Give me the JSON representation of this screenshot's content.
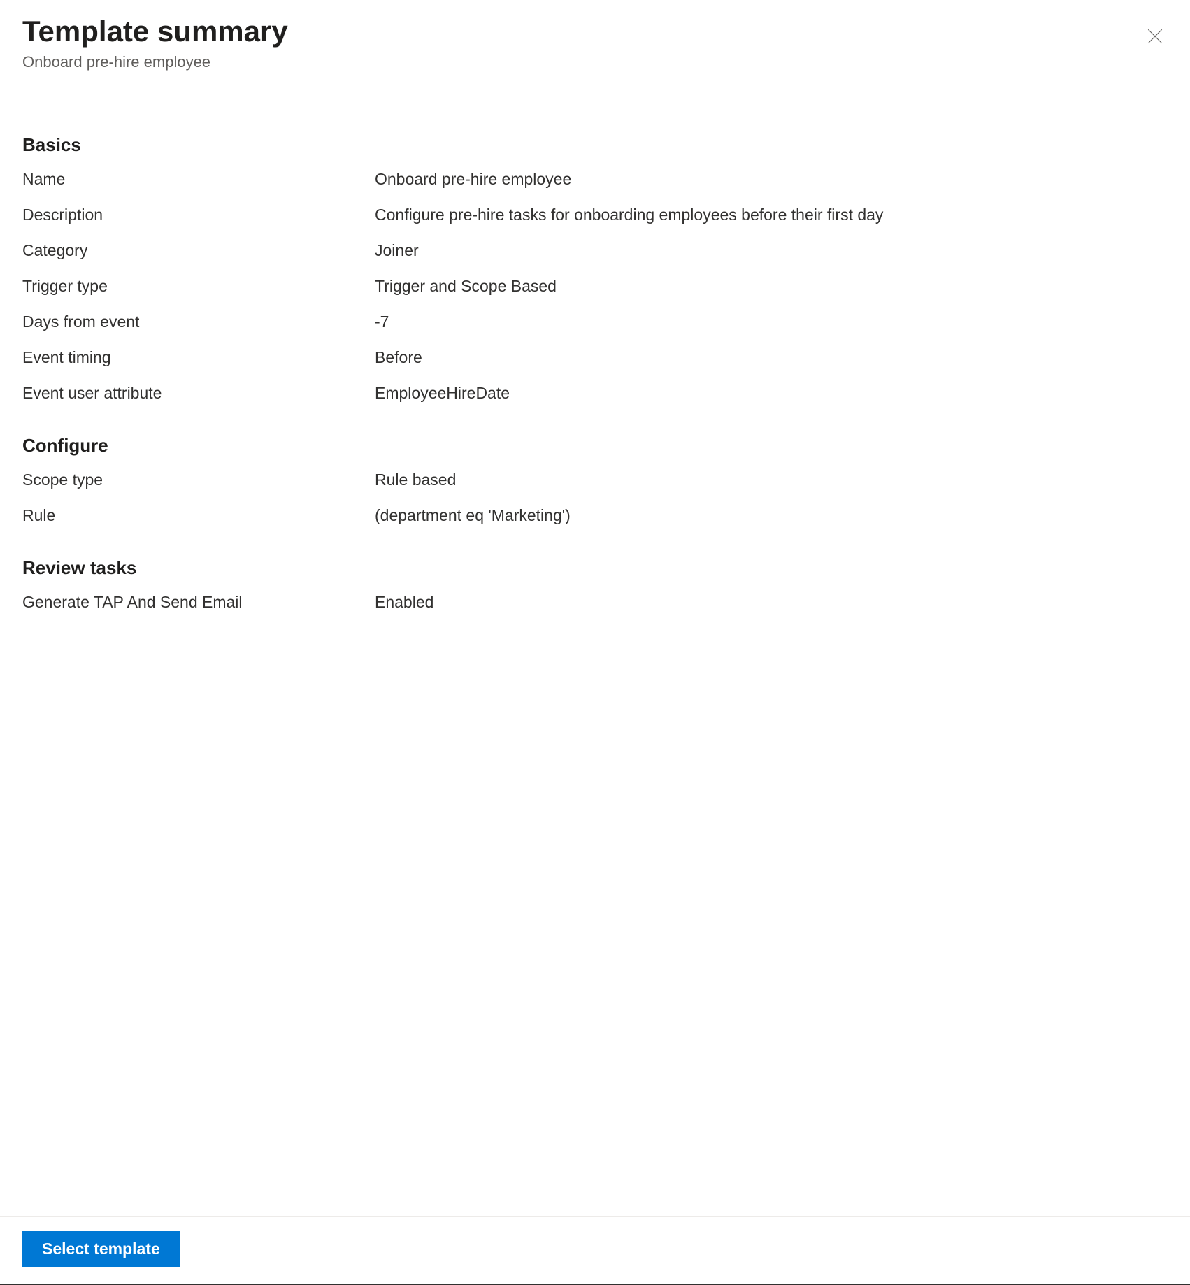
{
  "header": {
    "title": "Template summary",
    "subtitle": "Onboard pre-hire employee"
  },
  "sections": {
    "basics": {
      "heading": "Basics",
      "rows": [
        {
          "label": "Name",
          "value": "Onboard pre-hire employee"
        },
        {
          "label": "Description",
          "value": "Configure pre-hire tasks for onboarding employees before their first day"
        },
        {
          "label": "Category",
          "value": "Joiner"
        },
        {
          "label": "Trigger type",
          "value": "Trigger and Scope Based"
        },
        {
          "label": "Days from event",
          "value": "-7"
        },
        {
          "label": "Event timing",
          "value": "Before"
        },
        {
          "label": "Event user attribute",
          "value": "EmployeeHireDate"
        }
      ]
    },
    "configure": {
      "heading": "Configure",
      "rows": [
        {
          "label": "Scope type",
          "value": "Rule based"
        },
        {
          "label": "Rule",
          "value": "(department eq 'Marketing')"
        }
      ]
    },
    "reviewTasks": {
      "heading": "Review tasks",
      "rows": [
        {
          "label": "Generate TAP And Send Email",
          "value": "Enabled"
        }
      ]
    }
  },
  "footer": {
    "primaryButton": "Select template"
  }
}
